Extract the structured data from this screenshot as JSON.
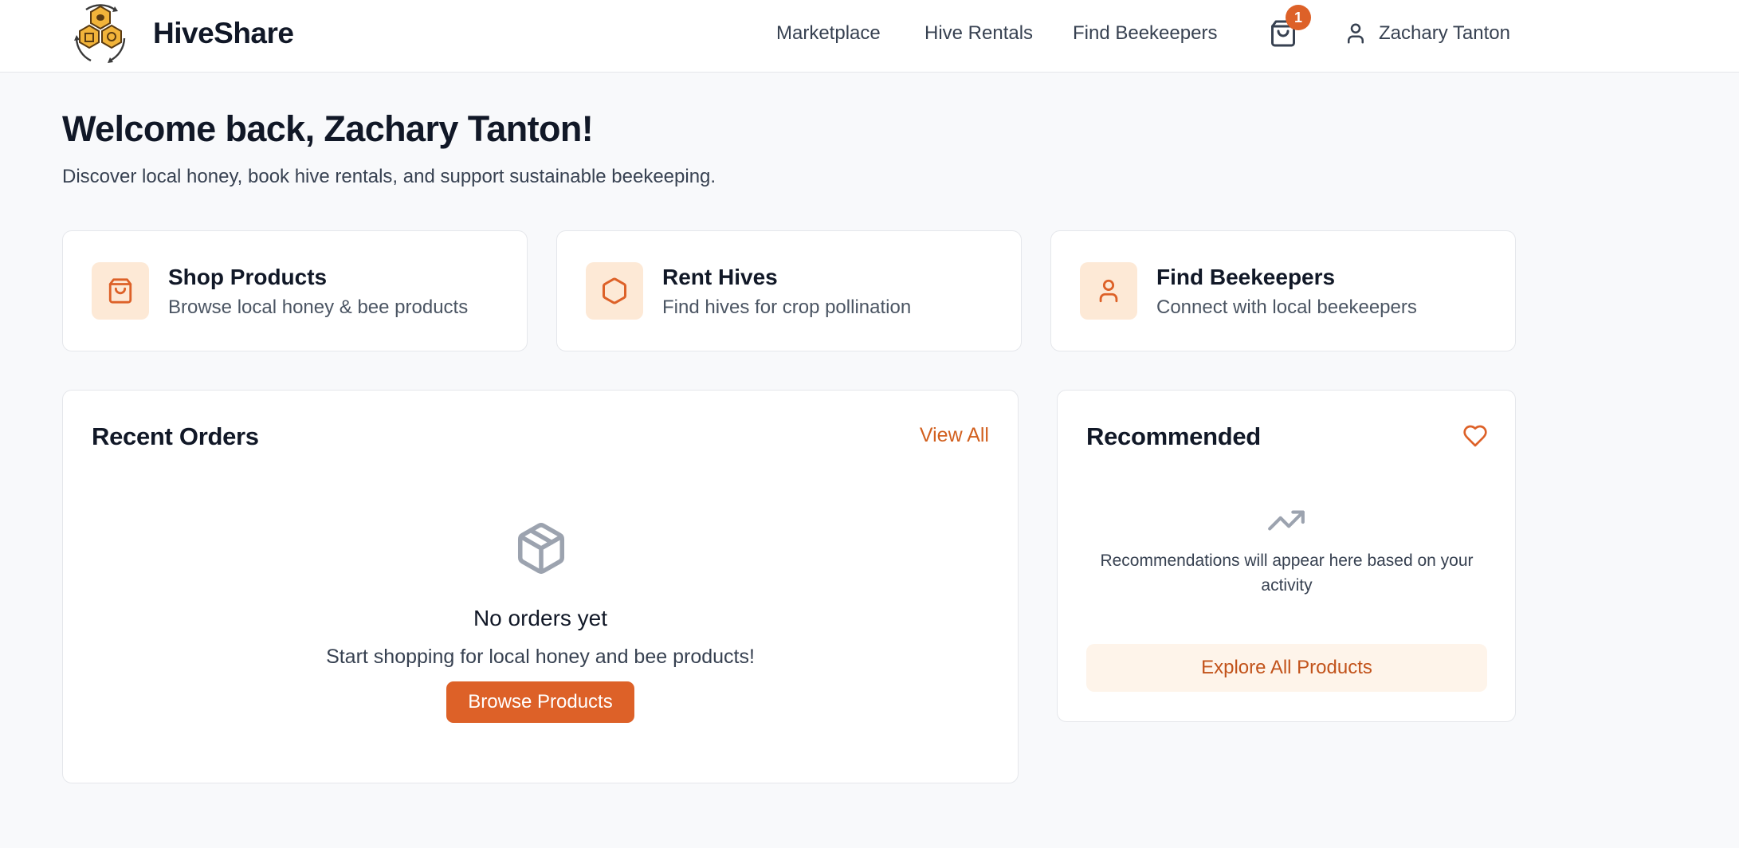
{
  "header": {
    "brand": "HiveShare",
    "nav": [
      "Marketplace",
      "Hive Rentals",
      "Find Beekeepers"
    ],
    "cart_count": "1",
    "user_name": "Zachary Tanton"
  },
  "welcome": {
    "title": "Welcome back, Zachary Tanton!",
    "subtitle": "Discover local honey, book hive rentals, and support sustainable beekeeping."
  },
  "quick_actions": [
    {
      "title": "Shop Products",
      "description": "Browse local honey & bee products",
      "icon": "shopping-bag-icon"
    },
    {
      "title": "Rent Hives",
      "description": "Find hives for crop pollination",
      "icon": "hexagon-icon"
    },
    {
      "title": "Find Beekeepers",
      "description": "Connect with local beekeepers",
      "icon": "user-icon"
    }
  ],
  "recent_orders": {
    "title": "Recent Orders",
    "view_all": "View All",
    "empty_title": "No orders yet",
    "empty_subtitle": "Start shopping for local honey and bee products!",
    "button": "Browse Products",
    "icon": "package-icon"
  },
  "recommended": {
    "title": "Recommended",
    "icon": "heart-icon",
    "empty_icon": "trending-up-icon",
    "message": "Recommendations will appear here based on your activity",
    "button": "Explore All Products"
  },
  "colors": {
    "accent": "#dd6128",
    "accent_text": "#d2601f",
    "icon_bg": "#fde9d6",
    "explore_bg": "#fef4ea",
    "page_bg": "#f8f9fb"
  }
}
